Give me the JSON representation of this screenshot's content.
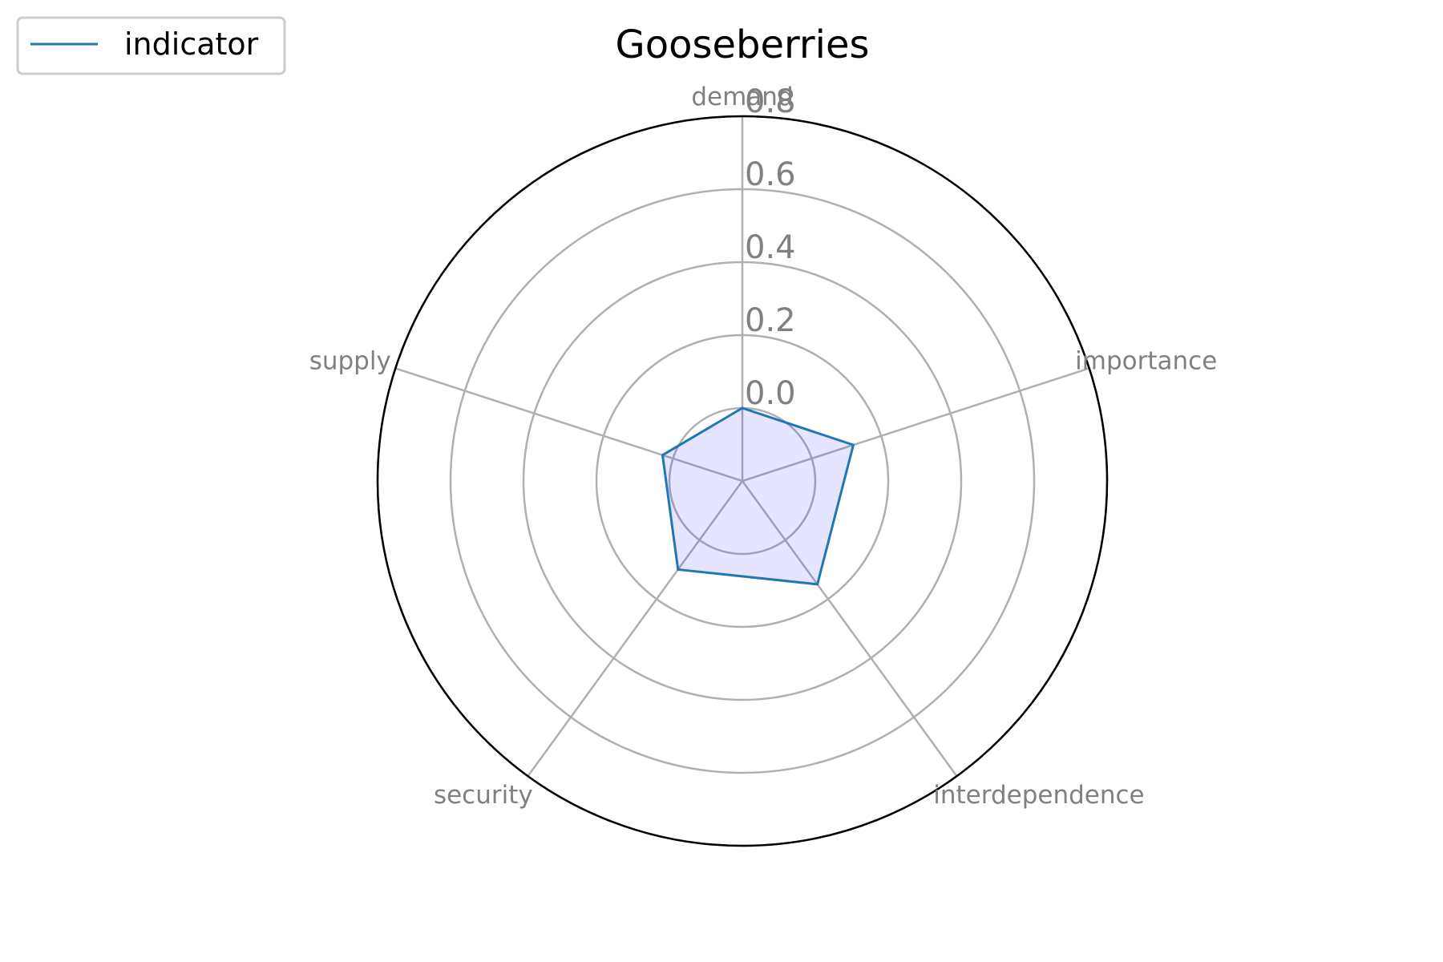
{
  "chart_data": {
    "type": "radar",
    "title": "Gooseberries",
    "categories": [
      "demand",
      "importance",
      "interdependence",
      "security",
      "supply"
    ],
    "series": [
      {
        "name": "indicator",
        "values": [
          0.0,
          0.12,
          0.15,
          0.1,
          0.03
        ],
        "color": "#1f77b4",
        "fill_color": "#0000ff",
        "fill_opacity": 0.1
      }
    ],
    "radial_ticks": [
      0.0,
      0.2,
      0.4,
      0.6,
      0.8
    ],
    "radial_tick_labels": [
      "0.0",
      "0.2",
      "0.4",
      "0.6",
      "0.8"
    ],
    "rlim": [
      -0.2,
      0.8
    ],
    "grid": true,
    "grid_color": "#b0b0b0",
    "label_color": "#808080",
    "legend": {
      "placement": "top-left"
    }
  }
}
